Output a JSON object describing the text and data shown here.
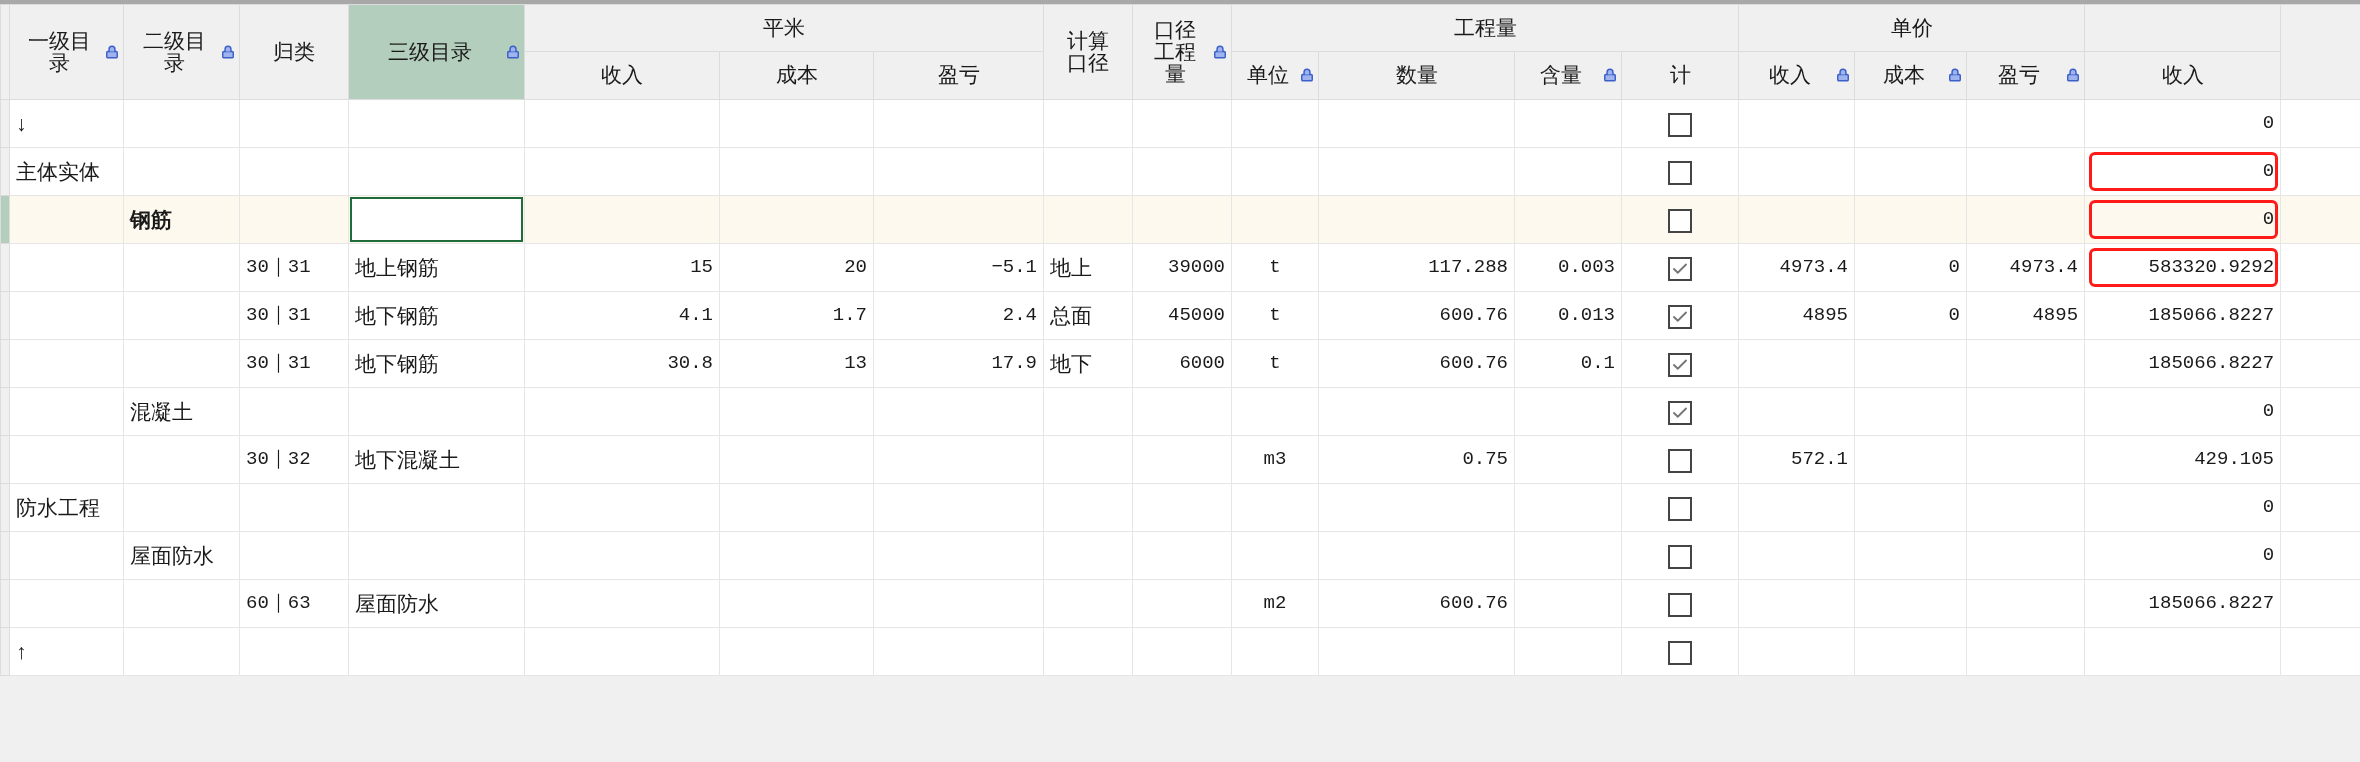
{
  "header": [
    {
      "label": "一级目录",
      "locked": true,
      "active": false
    },
    {
      "label": "二级目录",
      "locked": true,
      "active": false
    },
    {
      "label": "归类",
      "locked": false,
      "active": false
    },
    {
      "label": "三级目录",
      "locked": true,
      "active": true
    },
    {
      "label": "平米",
      "children": [
        {
          "label": "收入",
          "locked": false
        },
        {
          "label": "成本",
          "locked": false
        },
        {
          "label": "盈亏",
          "locked": false
        }
      ]
    },
    {
      "label": "计算口径",
      "locked": false,
      "active": false
    },
    {
      "label": "口径工程量",
      "locked": true,
      "active": false
    },
    {
      "label": "工程量",
      "children": [
        {
          "label": "单位",
          "locked": true
        },
        {
          "label": "数量",
          "locked": false
        },
        {
          "label": "含量",
          "locked": true
        },
        {
          "label": "计",
          "locked": false
        }
      ]
    },
    {
      "label": "单价",
      "children": [
        {
          "label": "收入",
          "locked": true
        },
        {
          "label": "成本",
          "locked": true
        },
        {
          "label": "盈亏",
          "locked": true
        }
      ]
    },
    {
      "children": [
        {
          "label": "收入",
          "locked": false
        }
      ]
    }
  ],
  "rows": [
    {
      "selected": false,
      "editing": false,
      "checked": false,
      "highlighted": false,
      "level1": "↓",
      "income": "0"
    },
    {
      "selected": false,
      "editing": false,
      "checked": false,
      "highlighted": true,
      "level1": "主体实体",
      "income": "0"
    },
    {
      "selected": true,
      "editing": true,
      "checked": false,
      "highlighted": true,
      "level2": "钢筋",
      "income": "0"
    },
    {
      "selected": false,
      "editing": false,
      "checked": true,
      "highlighted": true,
      "category": "30｜31",
      "level3": "地上钢筋",
      "sqm_income": "15",
      "sqm_cost": "20",
      "sqm_profit": "−5.1",
      "basis": "地上",
      "basis_qty": "39000",
      "unit": "t",
      "quantity": "117.288",
      "content": "0.003",
      "unit_income": "4973.4",
      "unit_cost": "0",
      "unit_profit": "4973.4",
      "income": "583320.9292"
    },
    {
      "selected": false,
      "editing": false,
      "checked": true,
      "highlighted": false,
      "category": "30｜31",
      "level3": "地下钢筋",
      "sqm_income": "4.1",
      "sqm_cost": "1.7",
      "sqm_profit": "2.4",
      "basis": "总面",
      "basis_qty": "45000",
      "unit": "t",
      "quantity": "600.76",
      "content": "0.013",
      "unit_income": "4895",
      "unit_cost": "0",
      "unit_profit": "4895",
      "income": "185066.8227"
    },
    {
      "selected": false,
      "editing": false,
      "checked": true,
      "highlighted": false,
      "category": "30｜31",
      "level3": "地下钢筋",
      "sqm_income": "30.8",
      "sqm_cost": "13",
      "sqm_profit": "17.9",
      "basis": "地下",
      "basis_qty": "6000",
      "unit": "t",
      "quantity": "600.76",
      "content": "0.1",
      "income": "185066.8227"
    },
    {
      "selected": false,
      "editing": false,
      "checked": true,
      "highlighted": false,
      "level2": "混凝土",
      "income": "0"
    },
    {
      "selected": false,
      "editing": false,
      "checked": false,
      "highlighted": false,
      "category": "30｜32",
      "level3": "地下混凝土",
      "unit": "m3",
      "quantity": "0.75",
      "unit_income": "572.1",
      "income": "429.105"
    },
    {
      "selected": false,
      "editing": false,
      "checked": false,
      "highlighted": false,
      "level1": "防水工程",
      "income": "0"
    },
    {
      "selected": false,
      "editing": false,
      "checked": false,
      "highlighted": false,
      "level2": "屋面防水",
      "income": "0"
    },
    {
      "selected": false,
      "editing": false,
      "checked": false,
      "highlighted": false,
      "category": "60｜63",
      "level3": "屋面防水",
      "unit": "m2",
      "quantity": "600.76",
      "income": "185066.8227"
    },
    {
      "selected": false,
      "editing": false,
      "checked": false,
      "highlighted": false,
      "level1": "↑"
    }
  ]
}
